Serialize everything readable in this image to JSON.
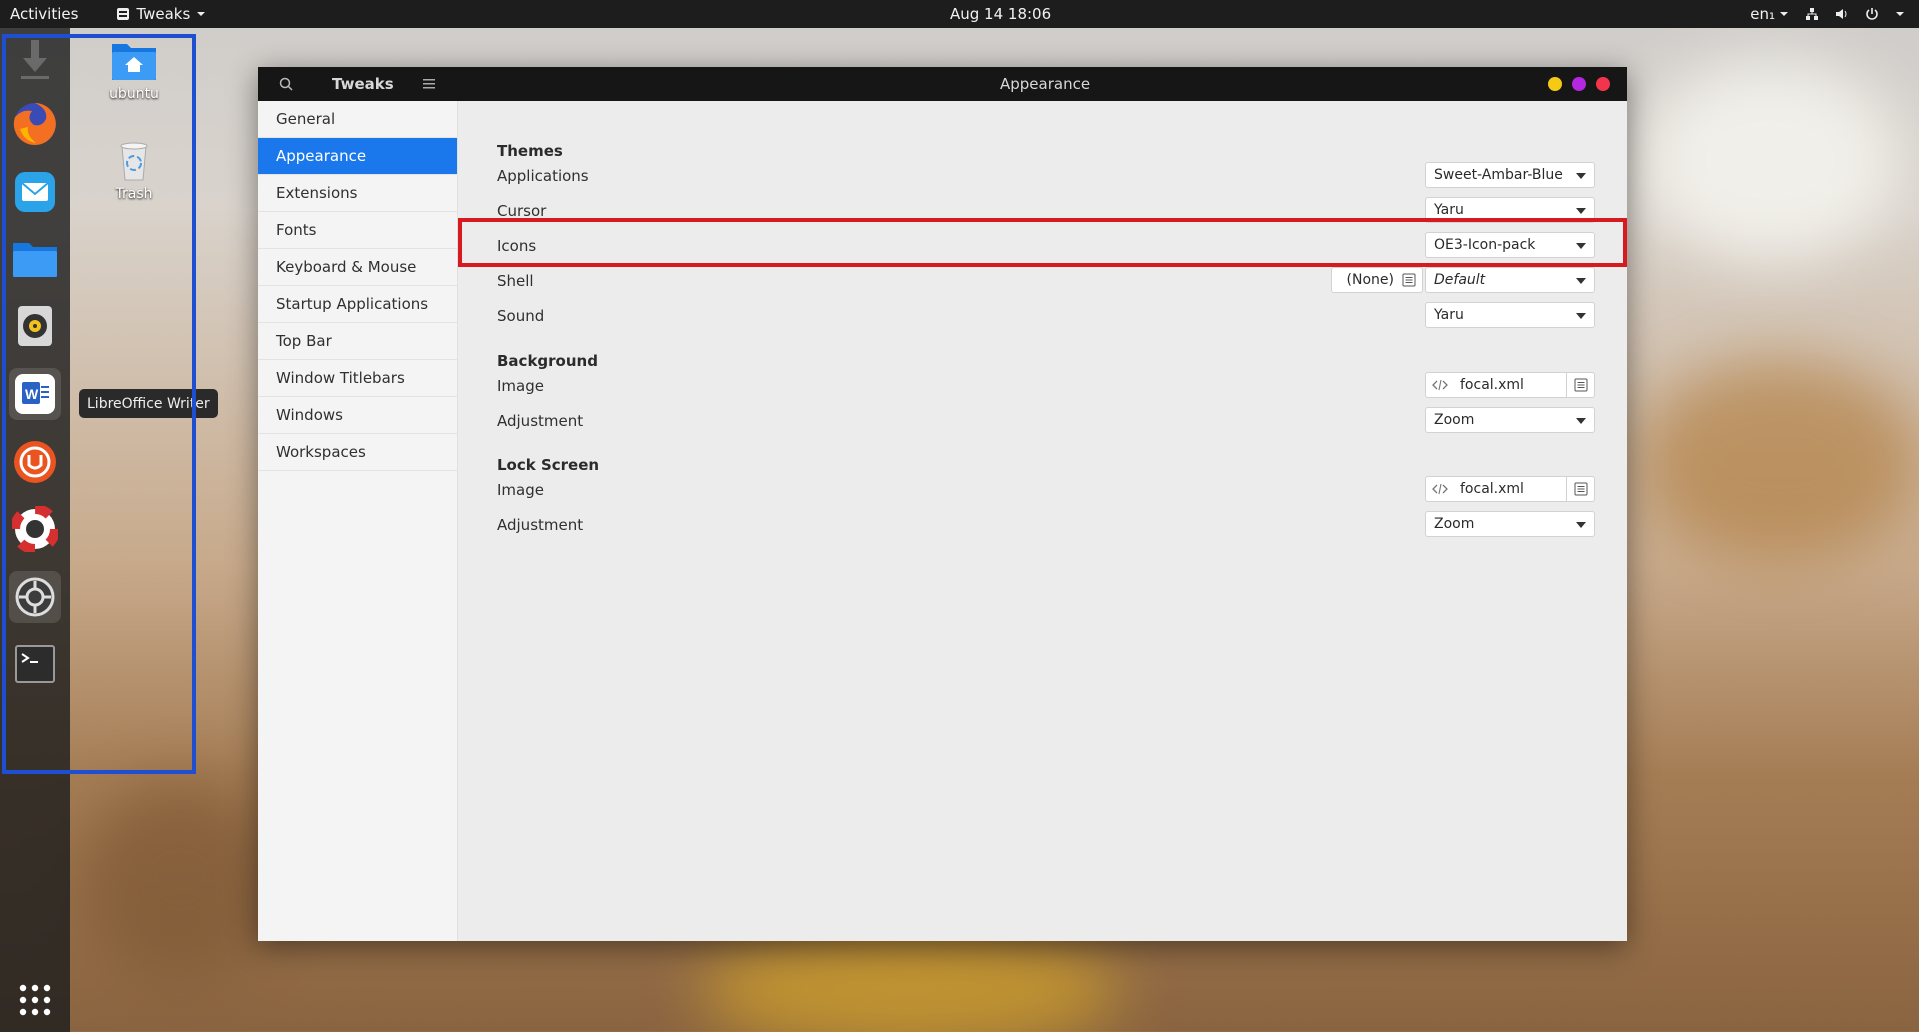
{
  "topbar": {
    "activities": "Activities",
    "app_name": "Tweaks",
    "clock": "Aug 14  18:06",
    "keyboard_layout": "en₁"
  },
  "dock": {
    "tooltip": "LibreOffice Writer",
    "items": [
      "downloads-icon",
      "firefox-icon",
      "mail-icon",
      "files-icon",
      "rhythmbox-icon",
      "writer-icon",
      "software-updater-icon",
      "help-icon",
      "settings-icon",
      "terminal-icon"
    ]
  },
  "desktop": {
    "home_label": "ubuntu",
    "trash_label": "Trash"
  },
  "window": {
    "app_title": "Tweaks",
    "page_title": "Appearance",
    "sidebar": [
      "General",
      "Appearance",
      "Extensions",
      "Fonts",
      "Keyboard & Mouse",
      "Startup Applications",
      "Top Bar",
      "Window Titlebars",
      "Windows",
      "Workspaces"
    ],
    "themes": {
      "title": "Themes",
      "applications_label": "Applications",
      "applications_value": "Sweet-Ambar-Blue",
      "cursor_label": "Cursor",
      "cursor_value": "Yaru",
      "icons_label": "Icons",
      "icons_value": "OE3-Icon-pack",
      "shell_label": "Shell",
      "shell_file": "(None)",
      "shell_value": "Default",
      "sound_label": "Sound",
      "sound_value": "Yaru"
    },
    "background": {
      "title": "Background",
      "image_label": "Image",
      "image_value": "focal.xml",
      "adjustment_label": "Adjustment",
      "adjustment_value": "Zoom"
    },
    "lockscreen": {
      "title": "Lock Screen",
      "image_label": "Image",
      "image_value": "focal.xml",
      "adjustment_label": "Adjustment",
      "adjustment_value": "Zoom"
    }
  },
  "colors": {
    "selection": "#1a78ec",
    "annotation_red": "#d61a1f",
    "annotation_blue": "#1e4fd0"
  }
}
